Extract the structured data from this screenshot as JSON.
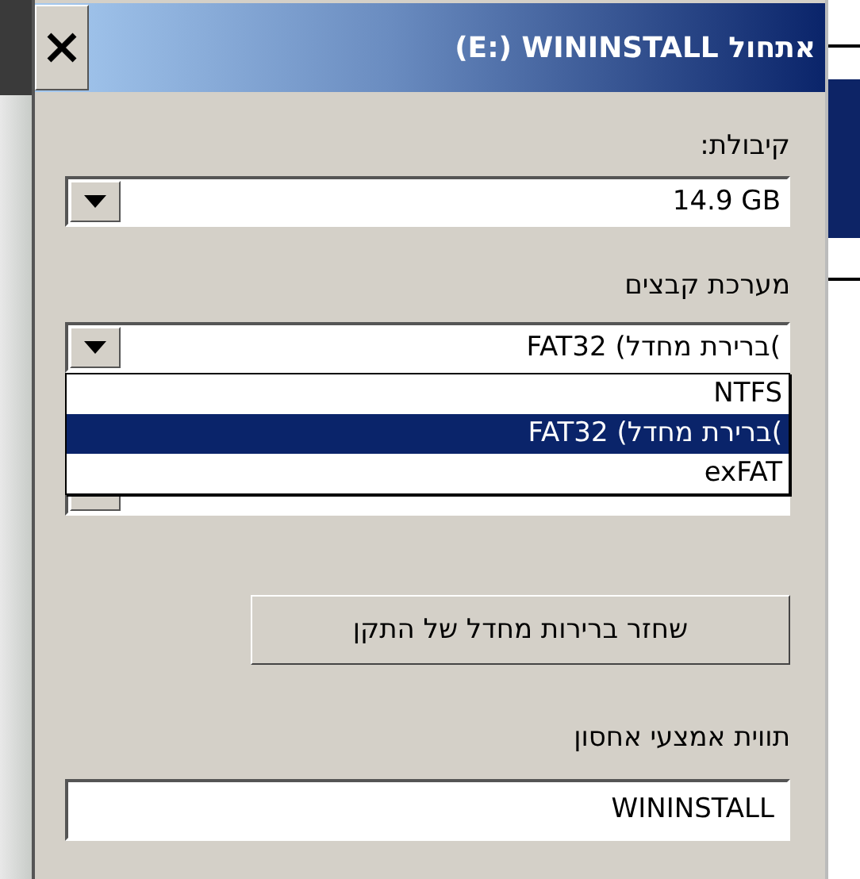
{
  "window": {
    "title": "(E:) WININSTALL אתחול"
  },
  "capacity": {
    "label": "קיבולת:",
    "value": "14.9 GB"
  },
  "file_system": {
    "label": "מערכת קבצים",
    "value": "FAT32 (ברירת מחדל(",
    "expanded": true,
    "options": [
      {
        "label": "NTFS",
        "selected": false
      },
      {
        "label": "FAT32 (ברירת מחדל(",
        "selected": true
      },
      {
        "label": "exFAT",
        "selected": false
      }
    ]
  },
  "restore_button": "שחזר ברירות מחדל של התקן",
  "volume_label": {
    "label": "תווית אמצעי אחסון",
    "value": "WININSTALL"
  }
}
